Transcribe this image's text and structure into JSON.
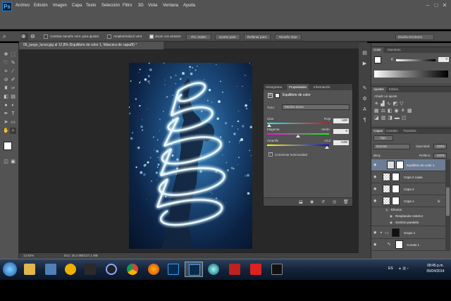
{
  "app": {
    "logo": "Ps"
  },
  "menubar": {
    "items": [
      "Archivo",
      "Edición",
      "Imagen",
      "Capa",
      "Texto",
      "Selección",
      "Filtro",
      "3D",
      "Vista",
      "Ventana",
      "Ayuda"
    ]
  },
  "options": {
    "resize_label": "Cambiar tamaño vent. para ajustar",
    "zoom_all_label": "Ampliar/reducir vent.",
    "scrubby_label": "Zoom con arrastre",
    "btn_actual": "Píx. reales",
    "btn_fit": "Ajustar pant.",
    "btn_fill": "Rellenar pant.",
    "btn_print": "Tamaño impr.",
    "workspace": "Diseño Escritorio"
  },
  "document": {
    "tab_title": "06_juego_luces.jpg al 12,8% (Equilibrio de color 1, Máscara de capa/8) *",
    "zoom": "13.82%",
    "doc_info": "Doc: 26,4 MB/127,1 MB"
  },
  "adjust_panel": {
    "tabs": [
      "Histograma",
      "Propiedades",
      "Información"
    ],
    "title": "Equilibrio de color",
    "tono_label": "Tono:",
    "tono_value": "Medios tonos",
    "sliders": [
      {
        "left": "Cian",
        "right": "Rojo",
        "value": "-100"
      },
      {
        "left": "Magenta",
        "right": "Verde",
        "value": "0"
      },
      {
        "left": "Amarillo",
        "right": "Azul",
        "value": "+100"
      }
    ],
    "preserve_label": "Conservar luminosidad",
    "preserve_checked": true
  },
  "color_panel": {
    "tabs": [
      "Color",
      "Muestras"
    ],
    "value": "0"
  },
  "adjustments_panel": {
    "tabs": [
      "Ajustes",
      "Estilos"
    ],
    "subtitle": "Añadir un ajuste"
  },
  "layers_panel": {
    "tabs": [
      "Capas",
      "Canales",
      "Trazados"
    ],
    "kind": "Tipo",
    "blend_mode": "Normal",
    "opacity_label": "Opacidad:",
    "opacity_value": "100%",
    "lock_label": "Bloq.:",
    "fill_label": "Relleno:",
    "fill_value": "100%",
    "layers": [
      {
        "name": "Equilibrio de color 1",
        "selected": true
      },
      {
        "name": "Capa 2 copia",
        "selected": false
      },
      {
        "name": "Capa 2",
        "selected": false
      },
      {
        "name": "Capa 1",
        "selected": false,
        "fx": "fx"
      },
      {
        "name": "Efectos",
        "selected": false
      },
      {
        "name": "Resplandor exterior",
        "selected": false
      },
      {
        "name": "Sombra paralela",
        "selected": false
      },
      {
        "name": "Grupo 1",
        "selected": false
      },
      {
        "name": "Curvas 1",
        "selected": false
      }
    ]
  },
  "taskbar": {
    "lang": "ES",
    "time": "08:45 p.m.",
    "date": "05/04/2014"
  },
  "colors": {
    "ui_bg": "#535353",
    "selected_layer": "#6c7d93",
    "taskbar": "#142338"
  }
}
